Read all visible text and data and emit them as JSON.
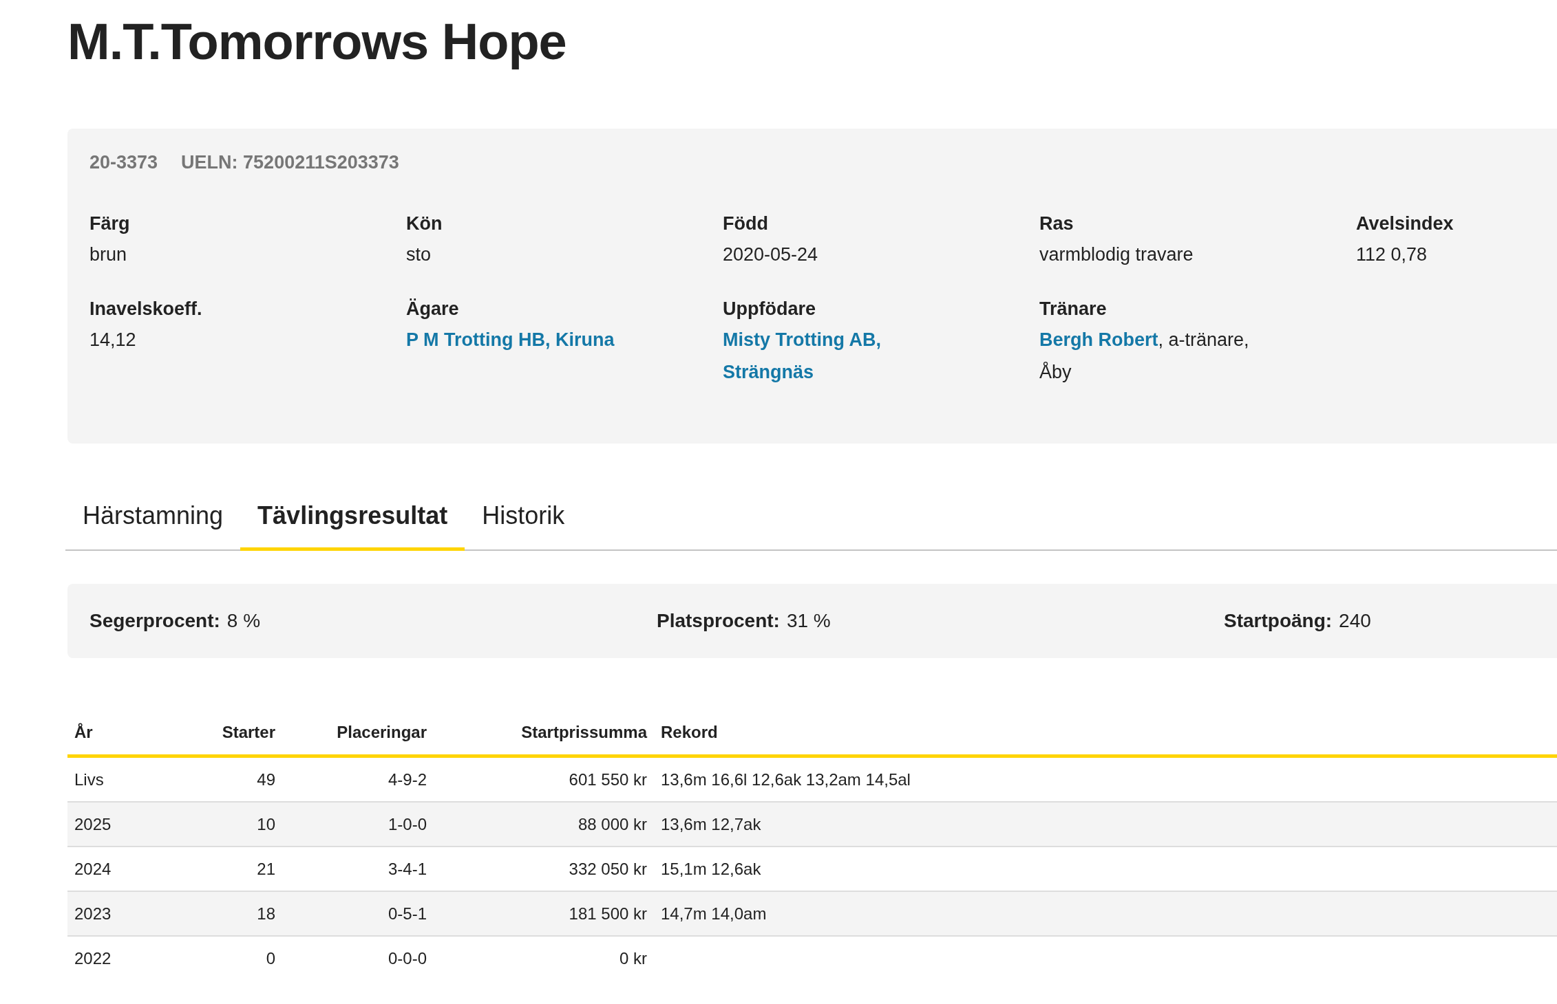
{
  "title": "M.T.Tomorrows Hope",
  "info": {
    "id": "20-3373",
    "ueln": "UELN: 75200211S203373",
    "fields": [
      {
        "label": "Färg",
        "value": [
          {
            "text": "brun",
            "link": false
          }
        ]
      },
      {
        "label": "Kön",
        "value": [
          {
            "text": "sto",
            "link": false
          }
        ]
      },
      {
        "label": "Född",
        "value": [
          {
            "text": "2020-05-24",
            "link": false
          }
        ]
      },
      {
        "label": "Ras",
        "value": [
          {
            "text": "varmblodig travare",
            "link": false
          }
        ]
      },
      {
        "label": "Avelsindex",
        "value": [
          {
            "text": "112 0,78",
            "link": false
          }
        ]
      },
      {
        "label": "Inavelskoeff.",
        "value": [
          {
            "text": "14,12",
            "link": false
          }
        ]
      },
      {
        "label": "Ägare",
        "value": [
          {
            "text": "P M Trotting HB, Kiruna",
            "link": true
          }
        ]
      },
      {
        "label": "Uppfödare",
        "value": [
          {
            "text": "Misty Trotting AB, Strängnäs",
            "link": true
          }
        ]
      },
      {
        "label": "Tränare",
        "value": [
          {
            "text": "Bergh Robert",
            "link": true
          },
          {
            "text": ", a-tränare, Åby",
            "link": false
          }
        ]
      }
    ]
  },
  "tabs": [
    {
      "label": "Härstamning",
      "selected": false
    },
    {
      "label": "Tävlingsresultat",
      "selected": true
    },
    {
      "label": "Historik",
      "selected": false
    }
  ],
  "stats": [
    {
      "label": "Segerprocent:",
      "value": "8 %"
    },
    {
      "label": "Platsprocent:",
      "value": "31 %"
    },
    {
      "label": "Startpoäng:",
      "value": "240"
    }
  ],
  "table": {
    "columns": [
      "År",
      "Starter",
      "Placeringar",
      "Startprissumma",
      "Rekord"
    ],
    "rows": [
      [
        "Livs",
        "49",
        "4-9-2",
        "601 550 kr",
        "13,6m 16,6l 12,6ak 13,2am 14,5al"
      ],
      [
        "2025",
        "10",
        "1-0-0",
        "88 000 kr",
        "13,6m 12,7ak"
      ],
      [
        "2024",
        "21",
        "3-4-1",
        "332 050 kr",
        "15,1m 12,6ak"
      ],
      [
        "2023",
        "18",
        "0-5-1",
        "181 500 kr",
        "14,7m 14,0am"
      ],
      [
        "2022",
        "0",
        "0-0-0",
        "0 kr",
        ""
      ]
    ]
  }
}
